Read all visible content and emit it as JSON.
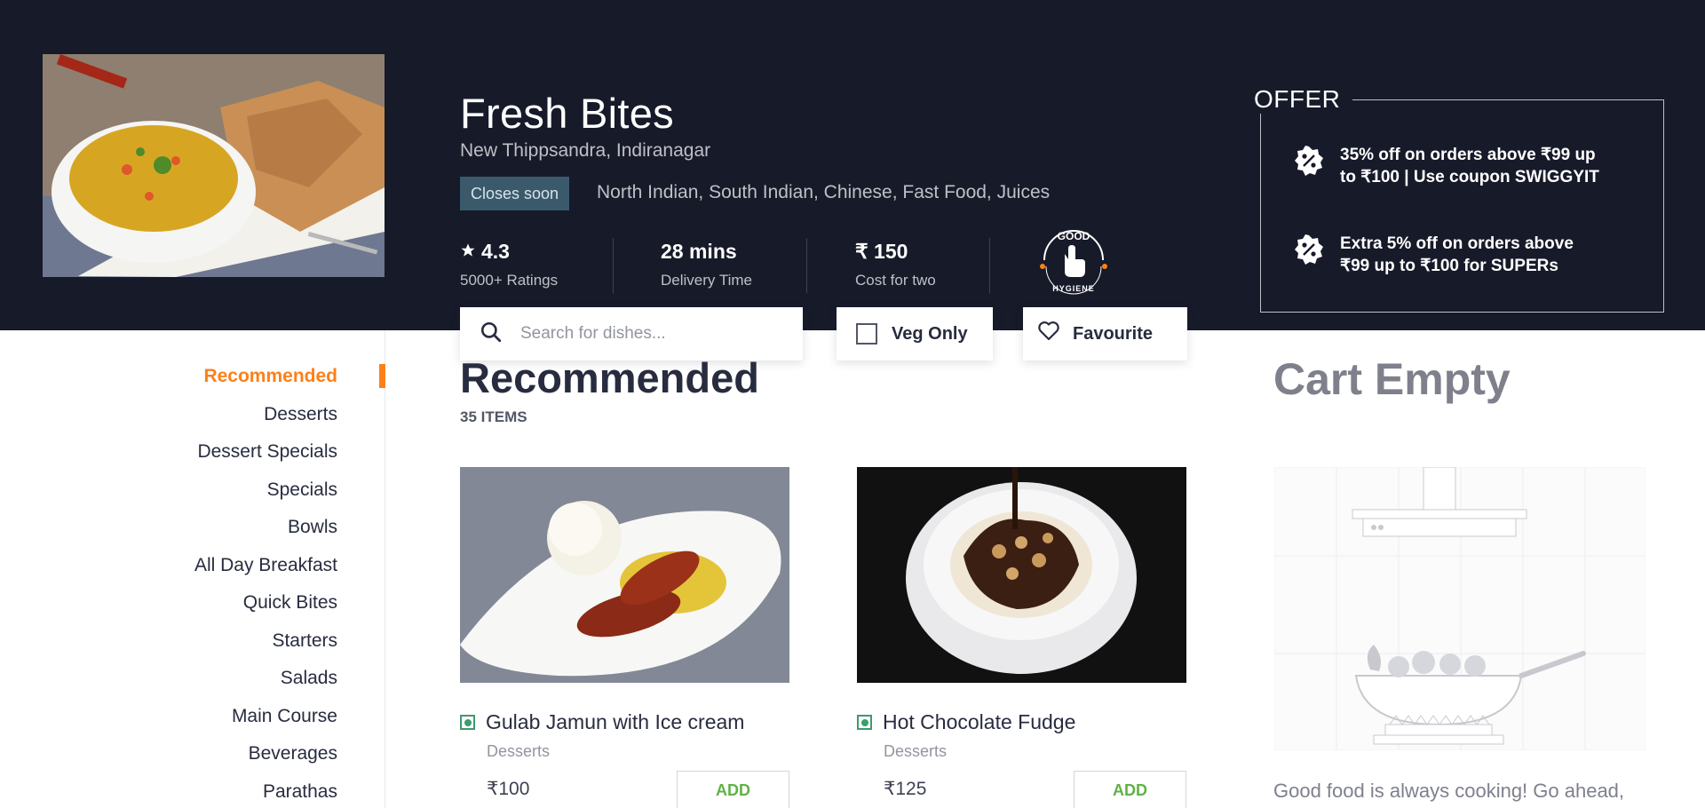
{
  "page_progress": 0.725,
  "restaurant": {
    "name": "Fresh Bites",
    "location": "New Thippsandra, Indiranagar",
    "status": "Closes soon",
    "cuisines": "North Indian, South Indian, Chinese, Fast Food, Juices",
    "rating": "4.3",
    "rating_label": "5000+ Ratings",
    "delivery_time": "28 mins",
    "delivery_label": "Delivery Time",
    "cost": "₹ 150",
    "cost_label": "Cost for two",
    "hygiene_top": "GOOD",
    "hygiene_bottom": "HYGIENE"
  },
  "offer": {
    "title": "OFFER",
    "items": [
      {
        "text": "35% off on orders above ₹99 up to ₹100 | Use coupon SWIGGYIT",
        "icon": "discount-icon"
      },
      {
        "text": "Extra 5% off on orders above ₹99 up to ₹100 for SUPERs",
        "icon": "discount-icon"
      }
    ]
  },
  "filters": {
    "search_placeholder": "Search for dishes...",
    "veg_only": "Veg Only",
    "favourite": "Favourite"
  },
  "sidebar": {
    "categories": [
      "Recommended",
      "Desserts",
      "Dessert Specials",
      "Specials",
      "Bowls",
      "All Day Breakfast",
      "Quick Bites",
      "Starters",
      "Salads",
      "Main Course",
      "Beverages",
      "Parathas"
    ],
    "active": "Recommended"
  },
  "section": {
    "title": "Recommended",
    "count": "35 ITEMS"
  },
  "items": [
    {
      "name": "Gulab Jamun with Ice cream",
      "category": "Desserts",
      "price": "₹100",
      "add_label": "ADD"
    },
    {
      "name": "Hot Chocolate Fudge",
      "category": "Desserts",
      "price": "₹125",
      "add_label": "ADD"
    }
  ],
  "cart": {
    "title": "Cart Empty",
    "message": "Good food is always cooking! Go ahead, order some yummy"
  },
  "colors": {
    "accent": "#fc8019",
    "header_bg": "#171a29",
    "veg_green": "#3d9b6d",
    "add_green": "#60b246"
  }
}
